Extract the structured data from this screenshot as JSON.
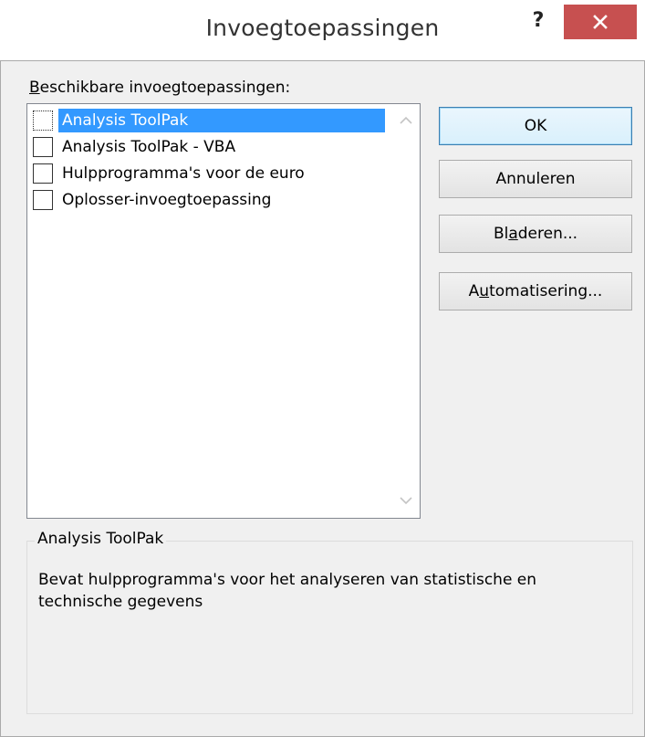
{
  "dialog": {
    "title": "Invoegtoepassingen",
    "help_label": "?",
    "close_label": "×"
  },
  "list": {
    "label_first": "B",
    "label_rest": "eschikbare invoegtoepassingen:",
    "items": [
      {
        "label": "Analysis ToolPak",
        "checked": false,
        "selected": true
      },
      {
        "label": "Analysis ToolPak - VBA",
        "checked": false,
        "selected": false
      },
      {
        "label": "Hulpprogramma's voor de euro",
        "checked": false,
        "selected": false
      },
      {
        "label": "Oplosser-invoegtoepassing",
        "checked": false,
        "selected": false
      }
    ]
  },
  "buttons": {
    "ok": "OK",
    "cancel": "Annuleren",
    "browse_pre": "Bl",
    "browse_u": "a",
    "browse_post": "deren...",
    "automation_pre": "A",
    "automation_u": "u",
    "automation_post": "tomatisering..."
  },
  "description": {
    "title": "Analysis ToolPak",
    "text": "Bevat hulpprogramma's voor het analyseren van statistische en technische gegevens"
  },
  "colors": {
    "selection": "#3399ff",
    "close_button": "#c75050",
    "dialog_bg": "#f0f0f0"
  }
}
